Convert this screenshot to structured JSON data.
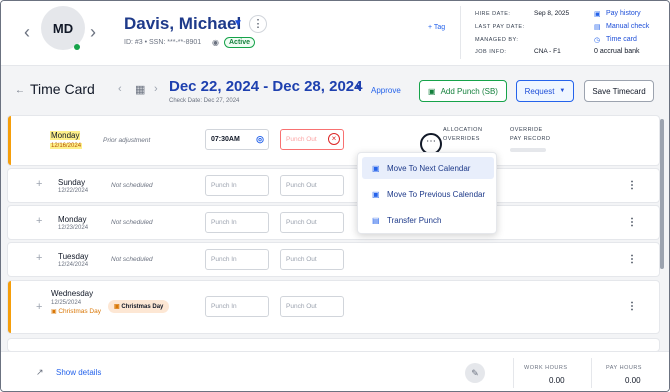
{
  "employee": {
    "initials": "MD",
    "name": "Davis, Michael",
    "id_line": "ID: #3 • SSN: ***-**-8901",
    "status": "Active",
    "tag_link": "+ Tag"
  },
  "info": {
    "hire_date_label": "HIRE DATE:",
    "hire_date": "Sep 8, 2025",
    "last_pay_label": "LAST PAY DATE:",
    "last_pay": "",
    "managed_by_label": "MANAGED BY:",
    "managed_by": "",
    "job_info_label": "JOB INFO:",
    "job_info": "CNA - F1"
  },
  "quick_links": {
    "pay_history": "Pay history",
    "manual_check": "Manual check",
    "time_card": "Time card",
    "accrual": "0 accrual bank"
  },
  "toolbar": {
    "title": "Time Card",
    "date_range": "Dec 22, 2024 - Dec 28, 2024",
    "check_date": "Check Date: Dec 27, 2024",
    "approve": "Approve",
    "add_punch": "Add Punch (SB)",
    "request": "Request",
    "save": "Save Timecard"
  },
  "row0": {
    "day": "Monday",
    "date": "12/16/2024",
    "note": "Prior adjustment",
    "punch_in": "07:30AM",
    "punch_out_placeholder": "Punch Out",
    "col1": "ALLOCATION",
    "col1b": "OVERRIDES",
    "col2": "OVERRIDE",
    "col2b": "PAY RECORD"
  },
  "rows": [
    {
      "day": "Sunday",
      "date": "12/22/2024",
      "note": "Not scheduled"
    },
    {
      "day": "Monday",
      "date": "12/23/2024",
      "note": "Not scheduled"
    },
    {
      "day": "Tuesday",
      "date": "12/24/2024",
      "note": "Not scheduled"
    },
    {
      "day": "Wednesday",
      "date": "12/25/2024",
      "holiday": "Christmas Day",
      "badge": "Christmas Day"
    }
  ],
  "placeholders": {
    "punch_in": "Punch In",
    "punch_out": "Punch Out"
  },
  "menu": {
    "item1": "Move To Next Calendar",
    "item2": "Move To Previous Calendar",
    "item3": "Transfer Punch"
  },
  "footer": {
    "show_details": "Show details",
    "work_hours_label": "WORK HOURS",
    "work_hours": "0.00",
    "pay_hours_label": "PAY HOURS",
    "pay_hours": "0.00"
  },
  "colors": {
    "accent": "#1e40af",
    "success": "#16a34a",
    "warning": "#f59e0b",
    "danger": "#dc2626"
  }
}
